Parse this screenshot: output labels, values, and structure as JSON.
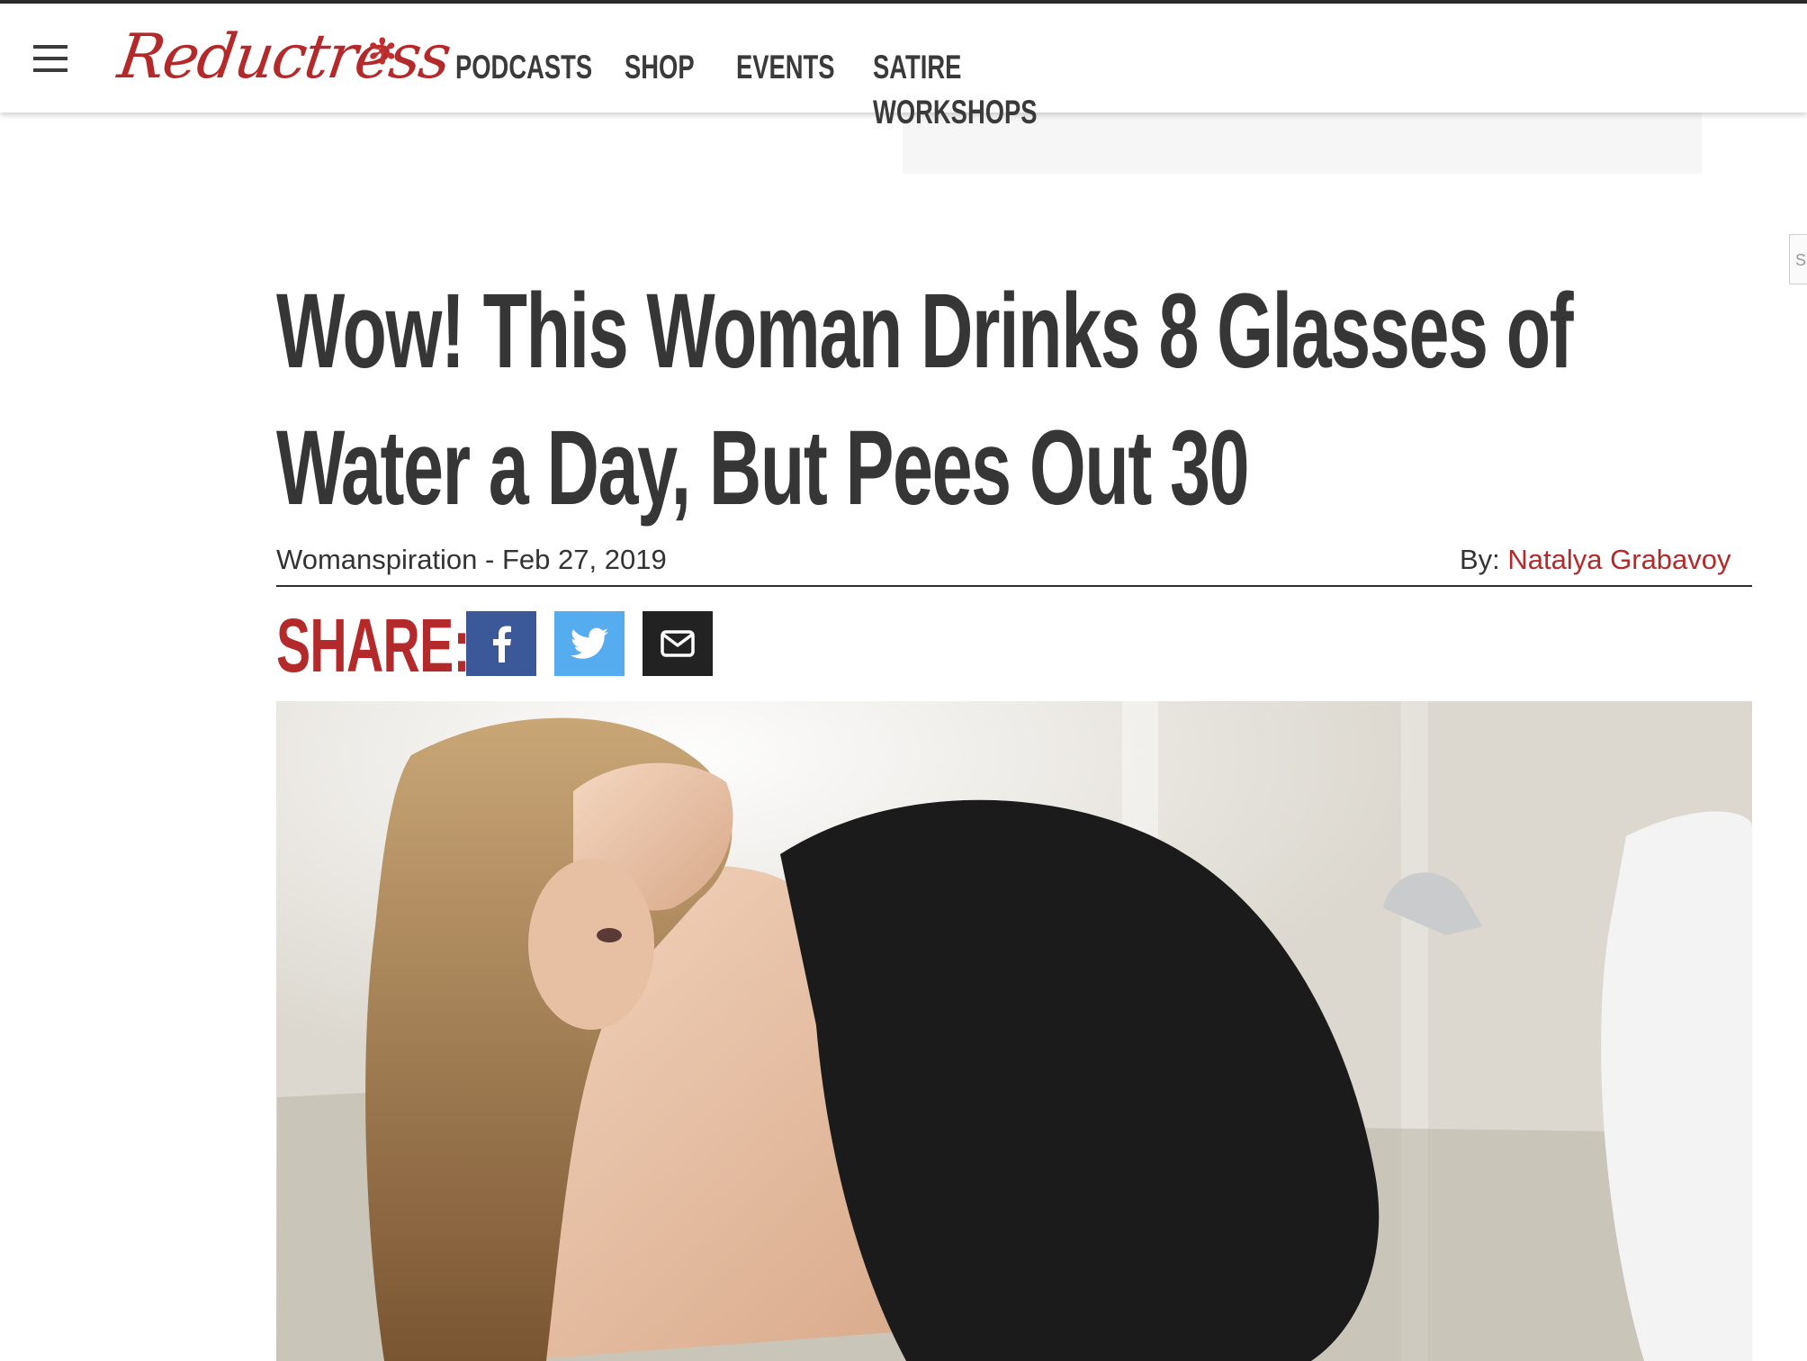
{
  "header": {
    "logo_text": "Reductress",
    "nav": [
      {
        "label": "PODCASTS"
      },
      {
        "label": "SHOP"
      },
      {
        "label": "EVENTS"
      },
      {
        "label": "SATIRE WORKSHOPS"
      }
    ],
    "menu_icon": "hamburger-menu-icon"
  },
  "edge_tab": {
    "label": "S"
  },
  "article": {
    "title": "Wow! This Woman Drinks 8 Glasses of Water a Day, But Pees Out 30",
    "category": "Womanspiration",
    "date_separator": " - ",
    "date": "Feb 27, 2019",
    "byline_prefix": "By: ",
    "author": "Natalya Grabavoy",
    "share_label": "SHARE:",
    "share_buttons": [
      {
        "network": "facebook",
        "icon": "facebook-icon",
        "color": "#3b5998"
      },
      {
        "network": "twitter",
        "icon": "twitter-icon",
        "color": "#55acee"
      },
      {
        "network": "email",
        "icon": "email-icon",
        "color": "#222222"
      }
    ]
  },
  "colors": {
    "brand_red": "#b42a2a",
    "text_dark": "#363636"
  }
}
